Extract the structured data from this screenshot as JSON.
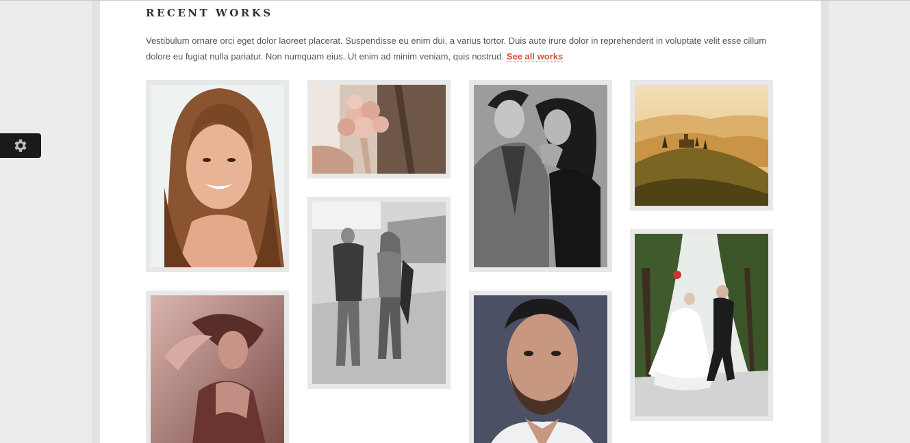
{
  "section": {
    "title": "Recent Works",
    "intro": "Vestibulum ornare orci eget dolor laoreet placerat. Suspendisse eu enim dui, a varius tortor. Duis aute irure dolor in reprehenderit in voluptate velit esse cillum dolore eu fugiat nulla pariatur. Non numquam eius. Ut enim ad minim veniam, quis nostrud.",
    "see_all_label": "See all works"
  },
  "settings": {
    "icon": "gear-icon"
  },
  "works": [
    {
      "name": "portrait-smiling-woman"
    },
    {
      "name": "wedding-bouquet"
    },
    {
      "name": "couple-embrace-bw"
    },
    {
      "name": "tuscany-landscape"
    },
    {
      "name": "woman-sepia-pose"
    },
    {
      "name": "couple-walking-bw"
    },
    {
      "name": "man-portrait"
    },
    {
      "name": "wedding-couple-jumping"
    }
  ],
  "colors": {
    "accent": "#d0543f",
    "tile_border": "#e8e8e8"
  }
}
